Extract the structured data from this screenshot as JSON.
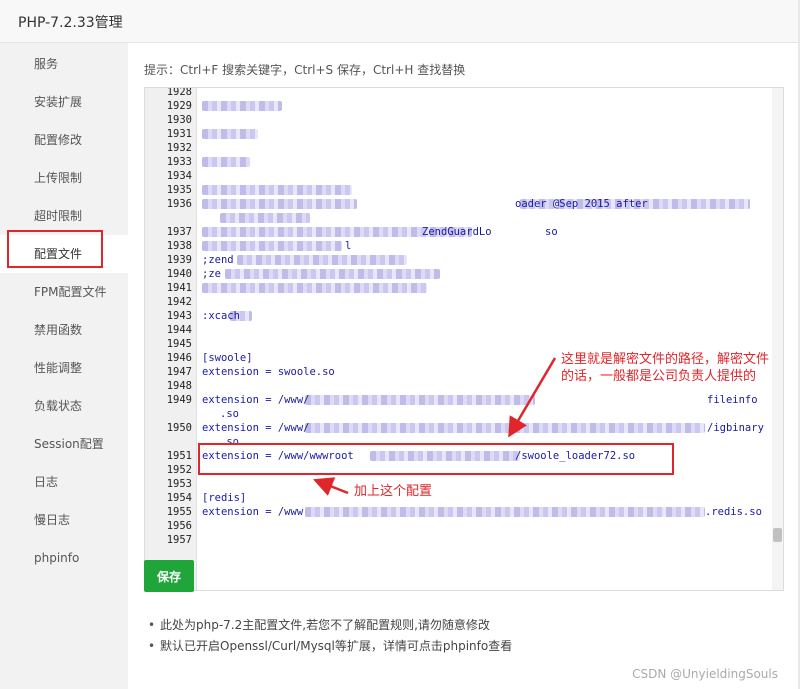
{
  "window": {
    "title": "PHP-7.2.33管理"
  },
  "sidebar": {
    "items": [
      {
        "label": "服务"
      },
      {
        "label": "安装扩展"
      },
      {
        "label": "配置修改"
      },
      {
        "label": "上传限制"
      },
      {
        "label": "超时限制"
      },
      {
        "label": "配置文件",
        "active": true
      },
      {
        "label": "FPM配置文件"
      },
      {
        "label": "禁用函数"
      },
      {
        "label": "性能调整"
      },
      {
        "label": "负载状态"
      },
      {
        "label": "Session配置"
      },
      {
        "label": "日志"
      },
      {
        "label": "慢日志"
      },
      {
        "label": "phpinfo"
      }
    ]
  },
  "editor": {
    "hint": "提示：Ctrl+F 搜索关键字，Ctrl+S 保存，Ctrl+H 查找替换",
    "line_numbers": [
      "1928",
      "1929",
      "1930",
      "1931",
      "1932",
      "1933",
      "1934",
      "1935",
      "1936",
      "1937",
      "1938",
      "1939",
      "1940",
      "1941",
      "1942",
      "1943",
      "1944",
      "1945",
      "1946",
      "1947",
      "1948",
      "1949",
      "1950",
      "1951",
      "1952",
      "1953",
      "1954",
      "1955",
      "1956",
      "1957"
    ],
    "visible_code": {
      "l1936_tail": "oader @Sep 2015 after",
      "l1937_tail": "ZendGuardLo",
      "l1937_end": "so",
      "l1938_tail": "l",
      "l1939": ";zend",
      "l1940": ";ze",
      "l1943": ":xcach",
      "l1946": "[swoole]",
      "l1947": "extension = swoole.so",
      "l1949_head": "extension = /www/",
      "l1949_tail": "fileinfo",
      "l1949_cont": ".so",
      "l1950_head": "extension = /www/",
      "l1950_tail": "/igbinary",
      "l1950_cont": ".so",
      "l1951_head": "extension = /www/wwwroot",
      "l1951_tail": "/swoole_loader72.so",
      "l1954": "[redis]",
      "l1955_head": "extension = /www",
      "l1955_tail": ".redis.so"
    }
  },
  "annotations": {
    "path_note": "这里就是解密文件的路径，解密文件的话，一般都是公司负责人提供的",
    "add_config": "加上这个配置"
  },
  "buttons": {
    "save": "保存"
  },
  "notes": [
    "此处为php-7.2主配置文件,若您不了解配置规则,请勿随意修改",
    "默认已开启Openssl/Curl/Mysql等扩展，详情可点击phpinfo查看"
  ],
  "watermark": "CSDN @UnyieldingSouls",
  "colors": {
    "accent": "#20a53a",
    "annotation": "#e0262b",
    "code": "#1a1aa6"
  }
}
